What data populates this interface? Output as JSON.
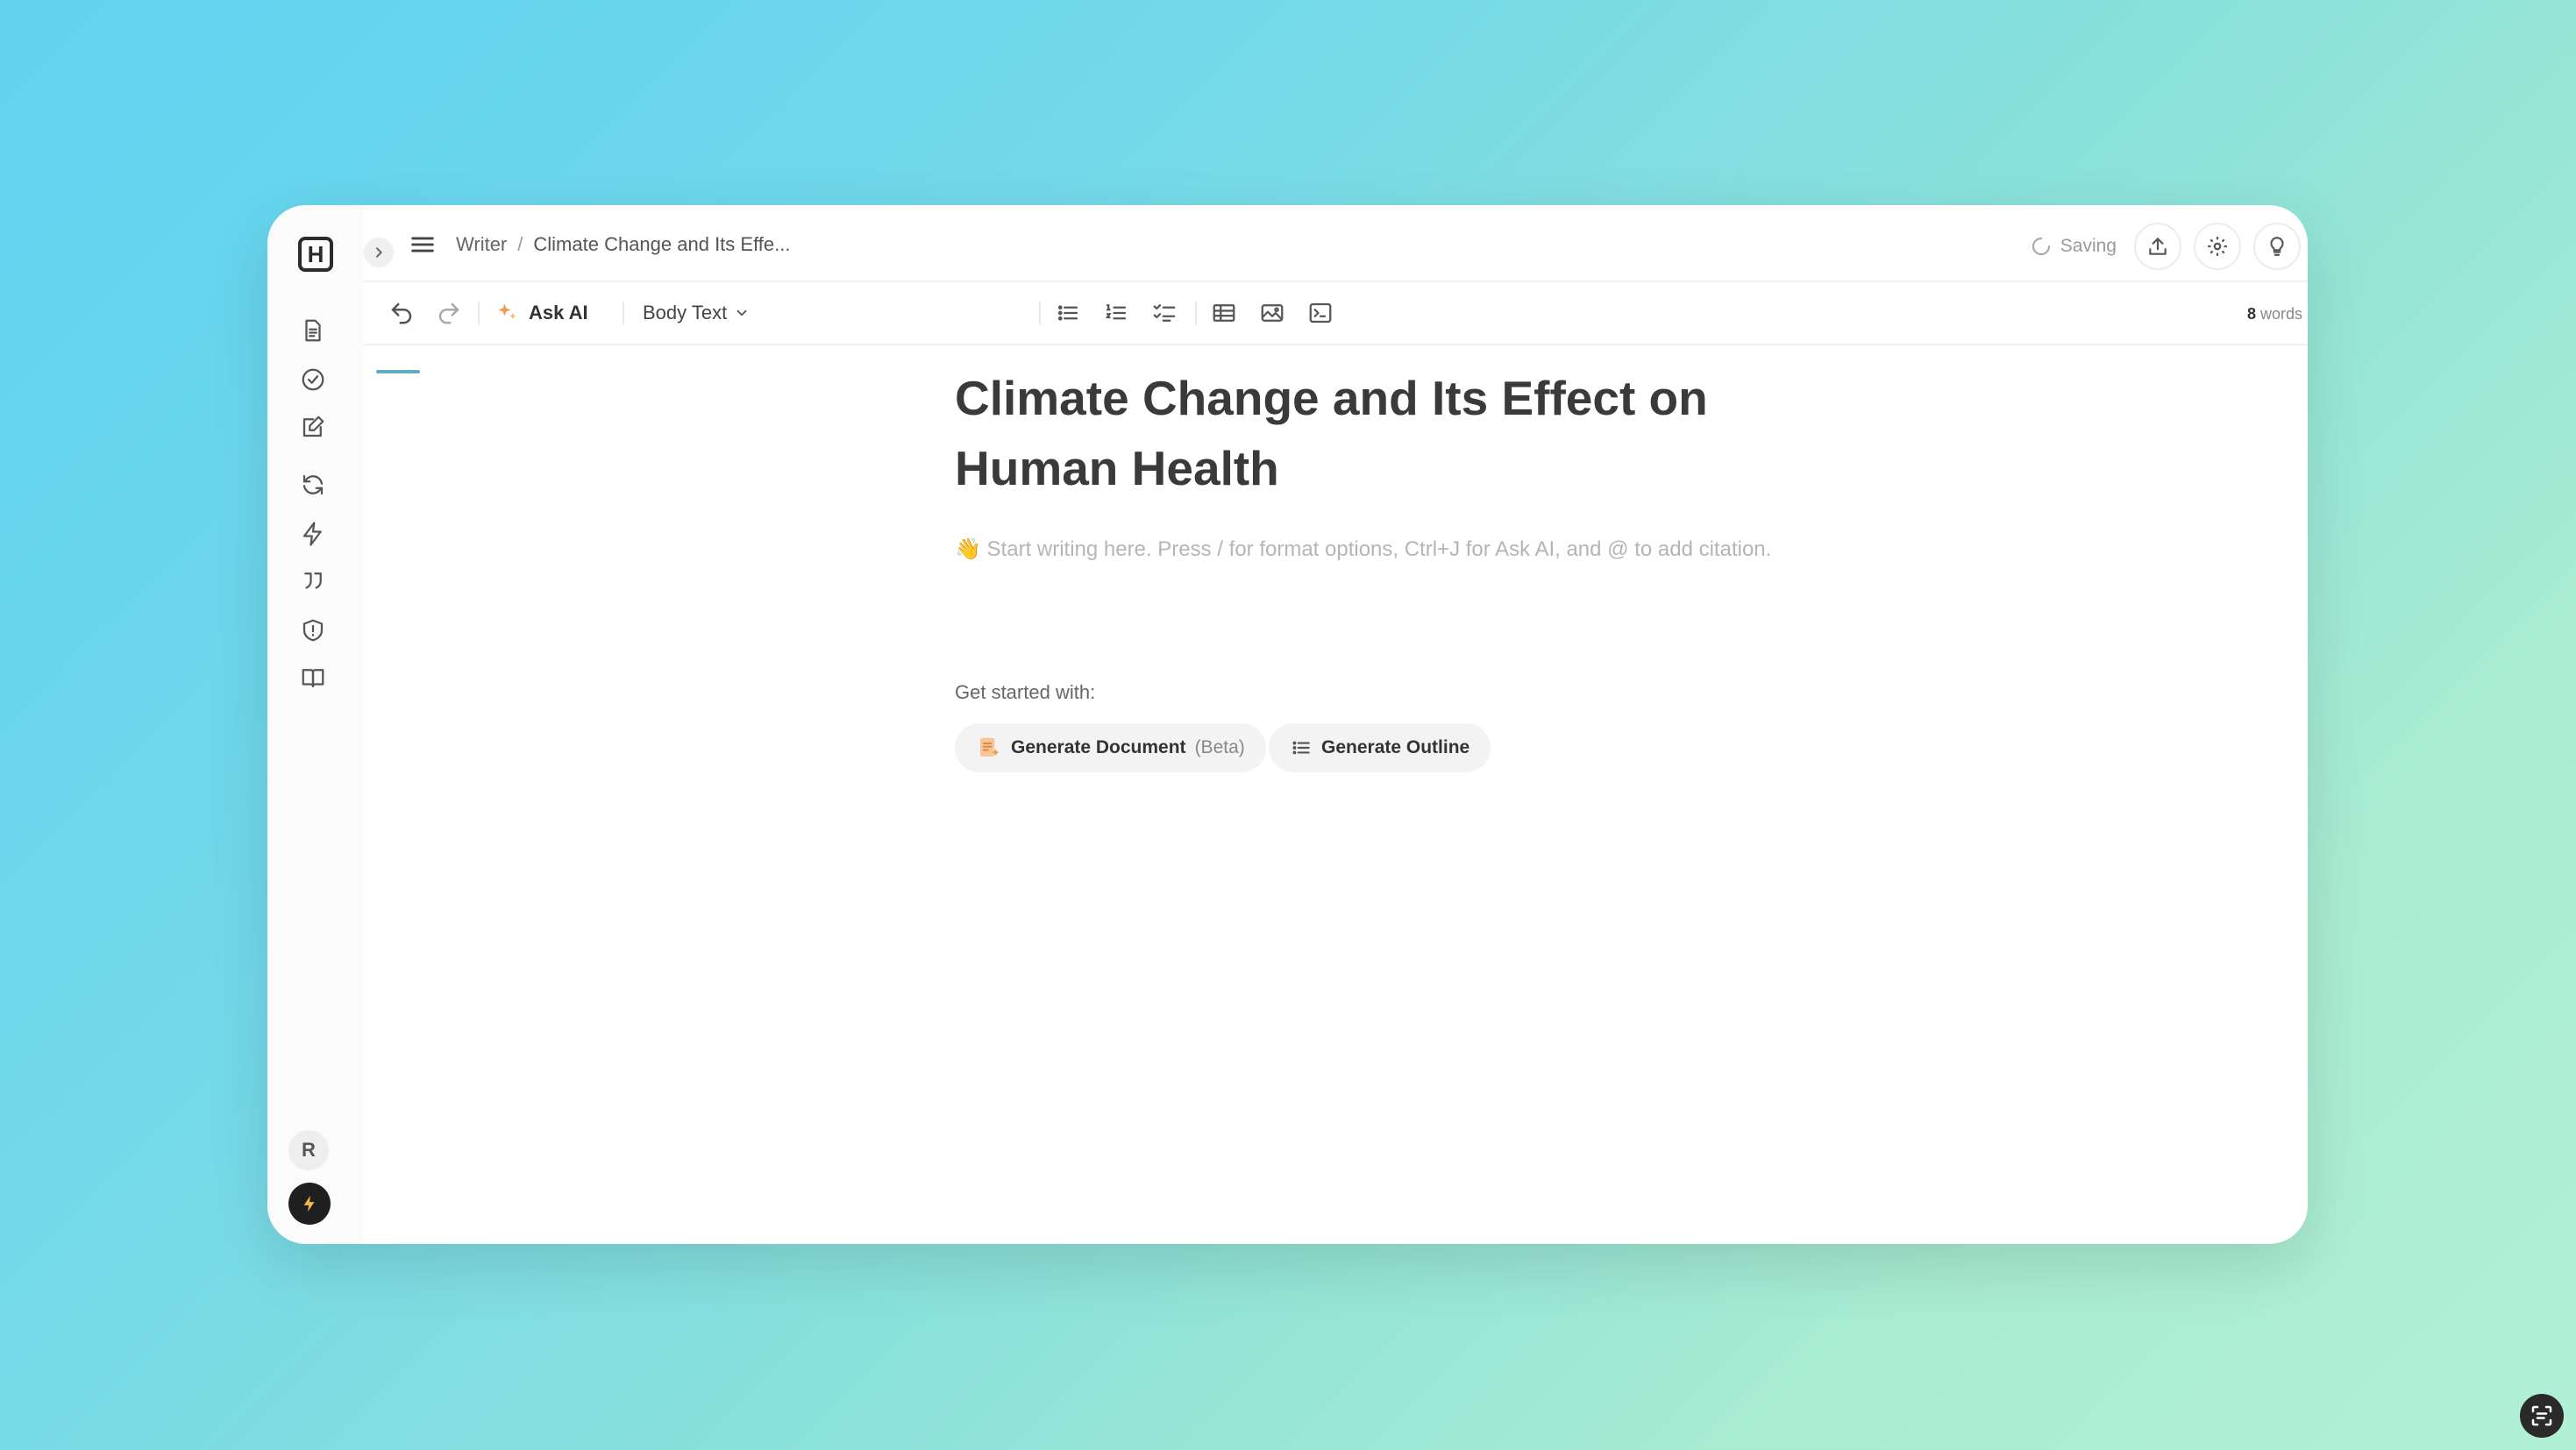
{
  "app": {
    "logo_letter": "H",
    "breadcrumb": {
      "root": "Writer",
      "separator": "/",
      "current": "Climate Change and Its Effe..."
    },
    "status": {
      "saving_label": "Saving"
    }
  },
  "sidebar": {
    "items": [
      {
        "name": "document-icon"
      },
      {
        "name": "check-circle-icon"
      },
      {
        "name": "edit-icon"
      },
      {
        "name": "refresh-icon"
      },
      {
        "name": "bolt-icon"
      },
      {
        "name": "quote-icon"
      },
      {
        "name": "shield-icon"
      },
      {
        "name": "book-icon"
      }
    ],
    "avatar_initial": "R"
  },
  "toolbar": {
    "ask_ai_label": "Ask AI",
    "text_style": "Body Text",
    "word_count": "8",
    "word_count_unit": "words"
  },
  "document": {
    "title": "Climate Change and Its Effect on Human Health",
    "placeholder": "👋 Start writing here. Press / for format options, Ctrl+J for Ask AI, and @ to add citation.",
    "get_started_label": "Get started with:",
    "actions": [
      {
        "label": "Generate Document",
        "tag": "(Beta)"
      },
      {
        "label": "Generate Outline"
      }
    ]
  },
  "colors": {
    "accent": "#5fb0c2",
    "ask_ai_icon": "#f39a4a",
    "text_primary": "#3a3a3a"
  }
}
